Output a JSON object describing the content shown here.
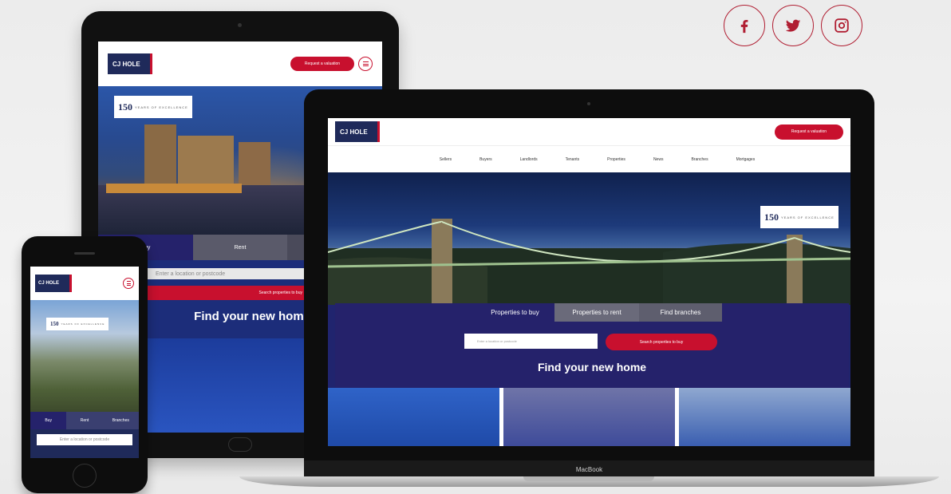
{
  "social": [
    "facebook-icon",
    "twitter-icon",
    "instagram-icon"
  ],
  "brand": {
    "logo_text": "CJ HOLE",
    "accent": "#c8102e",
    "navy": "#1f2a5a"
  },
  "badge": {
    "num": "150",
    "text": "YEARS OF EXCELLENCE"
  },
  "tablet": {
    "cta": "Request a valuation",
    "tabs": [
      "Buy",
      "Rent",
      ""
    ],
    "search_placeholder": "Enter a location or postcode",
    "search_button": "Search properties to buy",
    "find": "Find your new home"
  },
  "phone": {
    "tabs": [
      "Buy",
      "Rent",
      "Branches"
    ],
    "search_placeholder": "Enter a location or postcode"
  },
  "laptop": {
    "cta": "Request a valuation",
    "nav": [
      "Sellers",
      "Buyers",
      "Landlords",
      "Tenants",
      "Properties",
      "News",
      "Branches",
      "Mortgages"
    ],
    "tabs": [
      "Properties to buy",
      "Properties to rent",
      "Find branches"
    ],
    "search_placeholder": "Enter a location or postcode",
    "search_button": "Search properties to buy",
    "find": "Find your new home",
    "chin": "MacBook"
  }
}
